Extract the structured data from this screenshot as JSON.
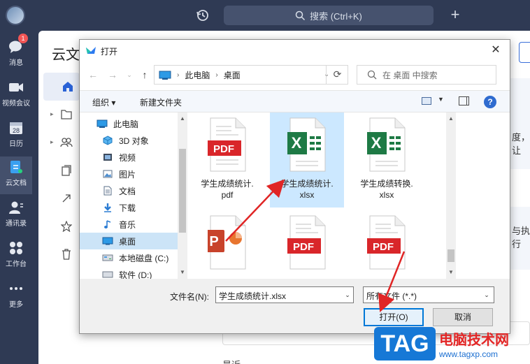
{
  "app": {
    "search_placeholder": "搜索 (Ctrl+K)",
    "badge_count": "1",
    "rail": [
      {
        "label": "消息",
        "icon": "chat-icon"
      },
      {
        "label": "视频会议",
        "icon": "video-icon"
      },
      {
        "label": "日历",
        "icon": "calendar-icon"
      },
      {
        "label": "云文档",
        "icon": "cloud-doc-icon"
      },
      {
        "label": "通讯录",
        "icon": "contacts-icon"
      },
      {
        "label": "工作台",
        "icon": "workbench-icon"
      },
      {
        "label": "更多",
        "icon": "more-icon"
      }
    ],
    "panel_title": "云文",
    "bg_fragments": [
      "度，让",
      "与执行",
      "最近"
    ],
    "calendar_day": "28"
  },
  "dialog": {
    "title": "打开",
    "address": [
      "此电脑",
      "桌面"
    ],
    "search_placeholder": "在 桌面 中搜索",
    "toolbar": {
      "organize": "组织 ▾",
      "new_folder": "新建文件夹"
    },
    "nav": [
      {
        "label": "此电脑",
        "icon": "pc-icon"
      },
      {
        "label": "3D 对象",
        "icon": "3d-objects-icon"
      },
      {
        "label": "视频",
        "icon": "videos-icon"
      },
      {
        "label": "图片",
        "icon": "pictures-icon"
      },
      {
        "label": "文档",
        "icon": "documents-icon"
      },
      {
        "label": "下载",
        "icon": "downloads-icon"
      },
      {
        "label": "音乐",
        "icon": "music-icon"
      },
      {
        "label": "桌面",
        "icon": "desktop-icon",
        "selected": true
      },
      {
        "label": "本地磁盘 (C:)",
        "icon": "disk-icon"
      },
      {
        "label": "软件 (D:)",
        "icon": "disk-icon"
      }
    ],
    "files": [
      {
        "name": "学生成绩统计.pdf",
        "line1": "学生成绩统计.",
        "line2": "pdf",
        "type": "pdf",
        "selected": false
      },
      {
        "name": "学生成绩统计.xlsx",
        "line1": "学生成绩统计.",
        "line2": "xlsx",
        "type": "xlsx",
        "selected": true
      },
      {
        "name": "学生成绩转换.xlsx",
        "line1": "学生成绩转换.",
        "line2": "xlsx",
        "type": "xlsx",
        "selected": false
      },
      {
        "name": "",
        "line1": "",
        "line2": "",
        "type": "pptx",
        "selected": false
      },
      {
        "name": "",
        "line1": "",
        "line2": "",
        "type": "pdf",
        "selected": false
      },
      {
        "name": "",
        "line1": "",
        "line2": "",
        "type": "pdf",
        "selected": false
      }
    ],
    "pdf_label": "PDF",
    "xlsx_letter": "X",
    "ppt_letter": "P",
    "filename_label": "文件名(N):",
    "filename_value": "学生成绩统计.xlsx",
    "filetype_value": "所有文件 (*.*)",
    "open_button": "打开(O)",
    "cancel_button": "取消"
  },
  "watermark": {
    "logo": "TAG",
    "title": "电脑技术网",
    "url": "www.tagxp.com"
  },
  "colors": {
    "accent": "#0078d7",
    "pdf_red": "#d9262a",
    "excel_green": "#1e7a45",
    "ppt_orange": "#c8432b",
    "arrow_red": "#e02525"
  }
}
